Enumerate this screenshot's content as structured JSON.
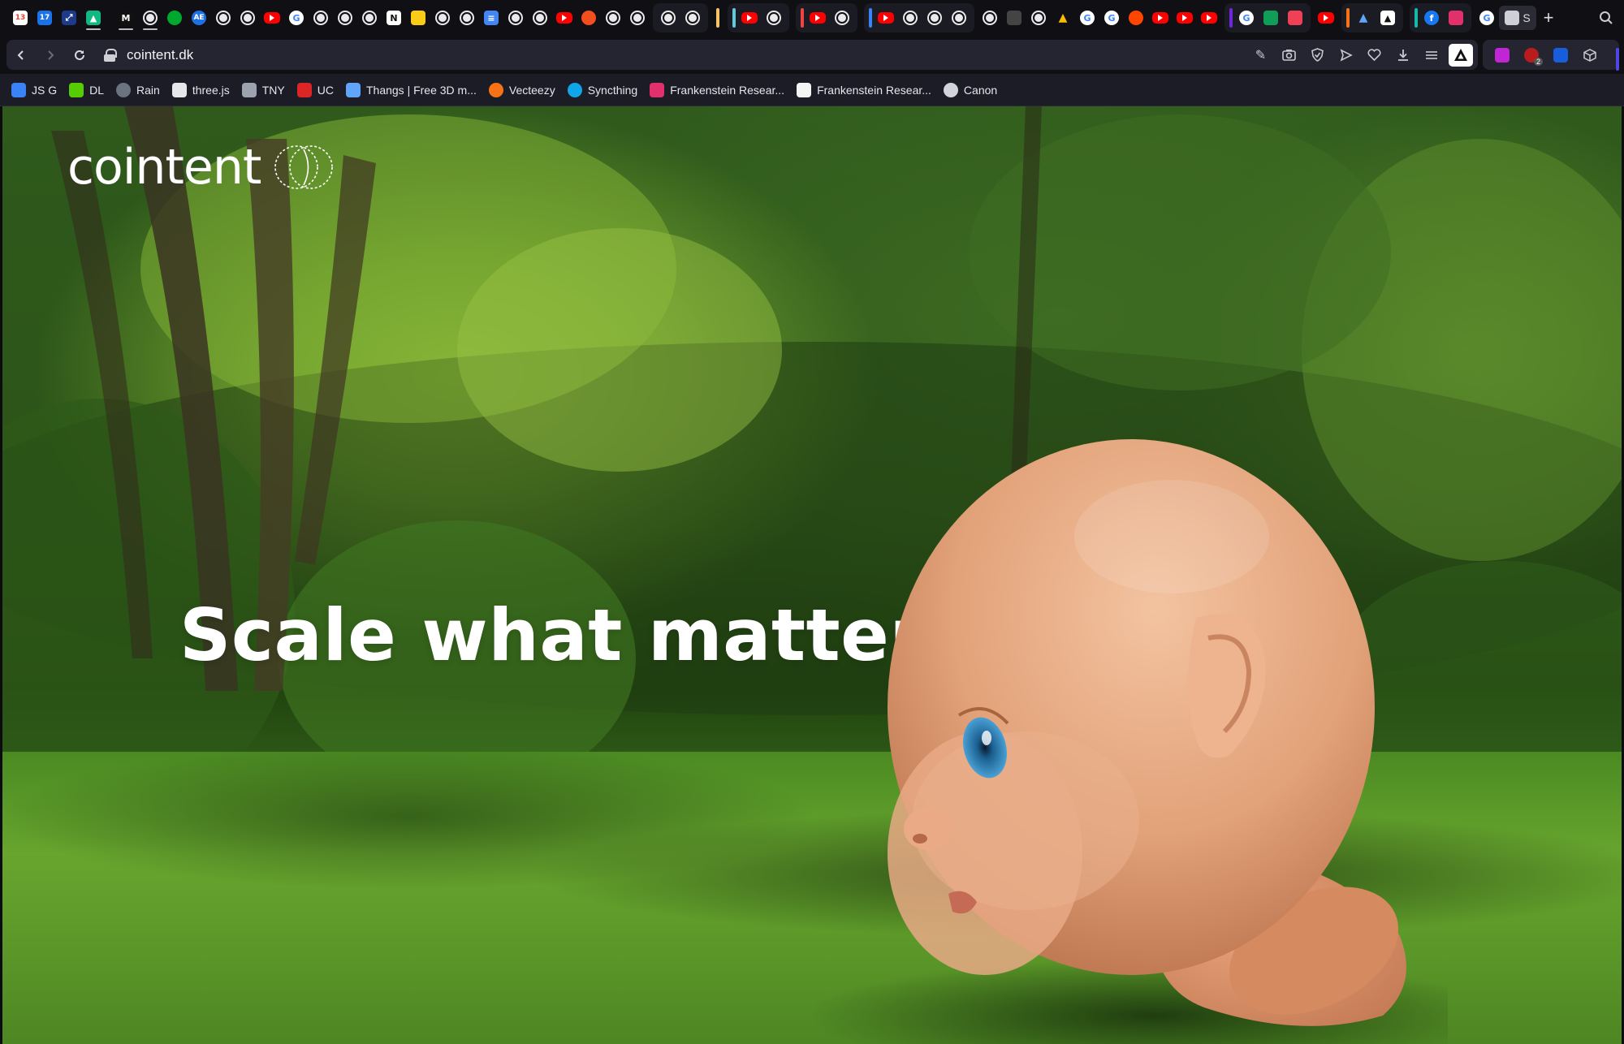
{
  "browser": {
    "tabs": {
      "icons": [
        "gmail-icon",
        "calendar-icon",
        "link-icon",
        "image-icon",
        "medium-icon",
        "globe-icon",
        "evernote-icon",
        "ae-icon",
        "globe-icon",
        "globe-icon",
        "youtube-icon",
        "google-icon",
        "globe-icon",
        "globe-icon",
        "globe-icon",
        "notion-icon",
        "folder-icon",
        "globe-icon",
        "globe-icon",
        "docs-icon",
        "globe-icon",
        "globe-icon",
        "youtube-icon",
        "figma-icon",
        "globe-icon",
        "globe-icon"
      ],
      "gmail_badge": "13",
      "calendar_day": "17",
      "active_tab_label": "S"
    },
    "address": {
      "url": "cointent.dk"
    },
    "extensions": {
      "badge_count": "2"
    },
    "bookmarks": [
      {
        "label": "JS G",
        "color": "#3b82f6"
      },
      {
        "label": "DL",
        "color": "#58cc02"
      },
      {
        "label": "Rain",
        "color": "#6b7280"
      },
      {
        "label": "three.js",
        "color": "#e5e7eb"
      },
      {
        "label": "TNY",
        "color": "#9ca3af"
      },
      {
        "label": "UC",
        "color": "#dc2626"
      },
      {
        "label": "Thangs | Free 3D m...",
        "color": "#60a5fa"
      },
      {
        "label": "Vecteezy",
        "color": "#f97316"
      },
      {
        "label": "Syncthing",
        "color": "#0ea5e9"
      },
      {
        "label": "Frankenstein Resear...",
        "color": "#e1306c"
      },
      {
        "label": "Frankenstein Resear...",
        "color": "#f5f5f5"
      },
      {
        "label": "Canon",
        "color": "#d1d5db"
      }
    ]
  },
  "page": {
    "logo_text": "cointent",
    "headline": "Scale what matters."
  }
}
